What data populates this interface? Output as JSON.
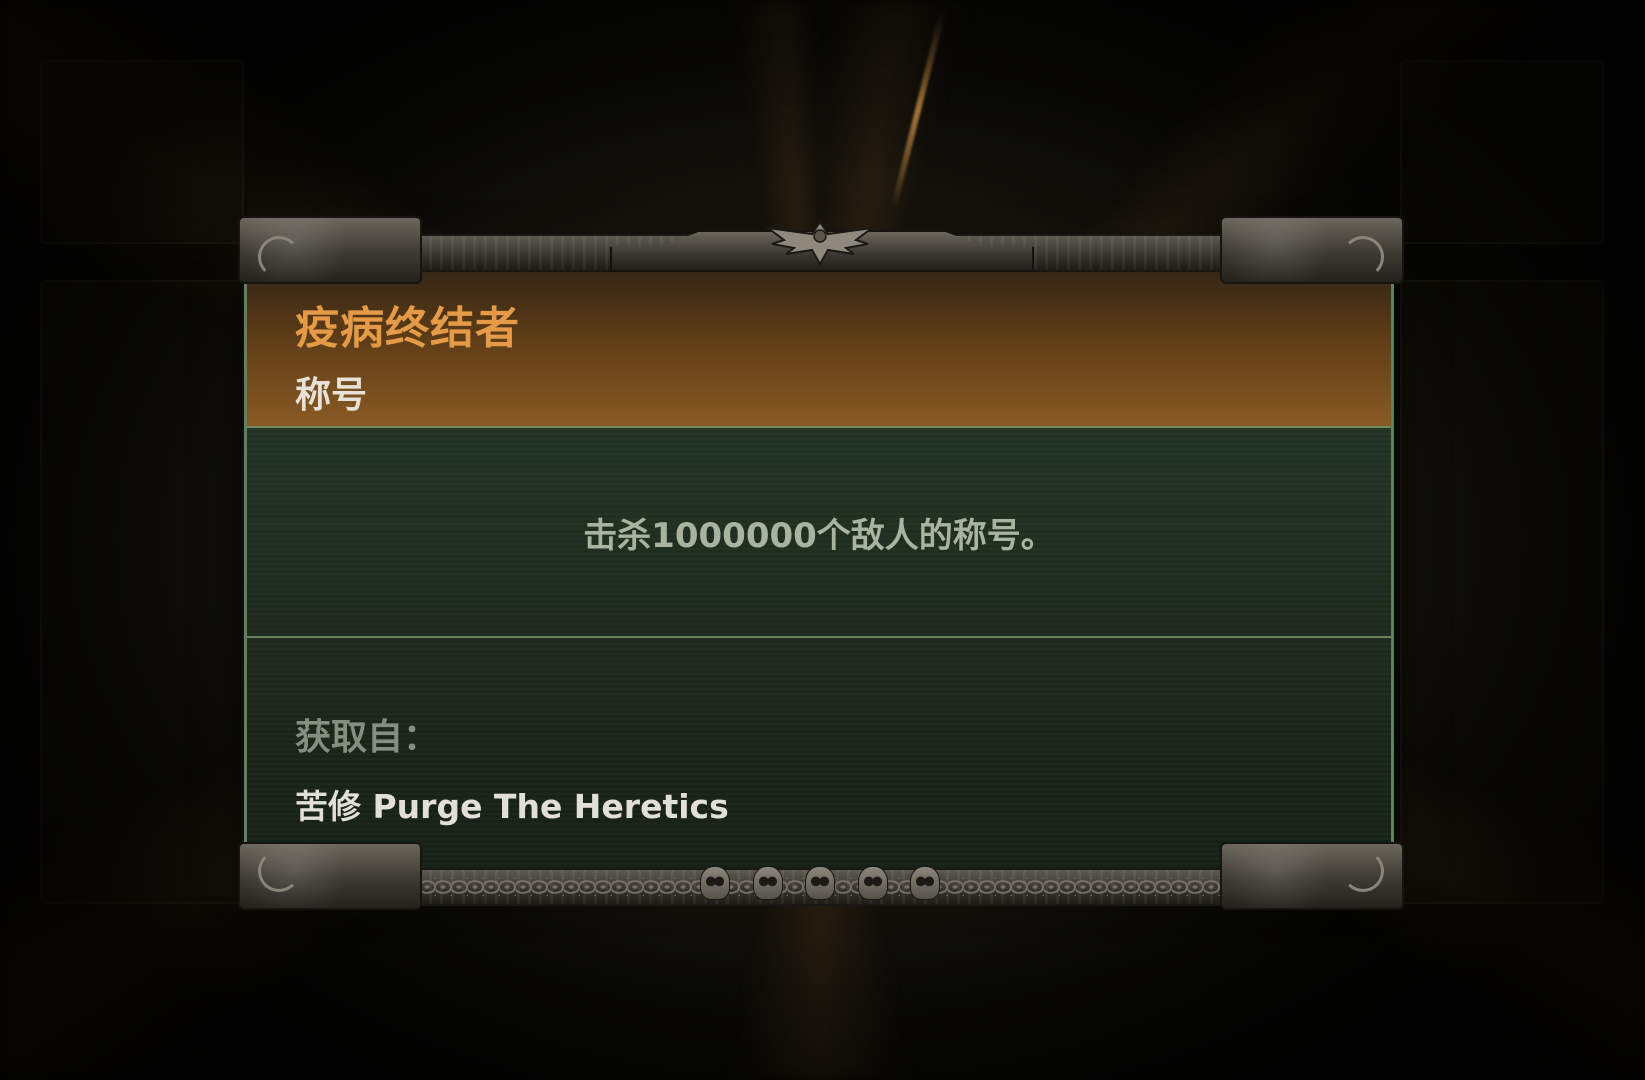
{
  "card": {
    "title": "疫病终结者",
    "category": "称号",
    "description": "击杀1000000个敌人的称号。",
    "source_label": "获取自：",
    "source_value": "苦修 Purge The Heretics"
  },
  "colors": {
    "title": "#e59a47",
    "header_gradient_end": "#8a5a24",
    "panel_green": "#1f2a1f",
    "border_green": "#6b8460"
  },
  "icons": {
    "crest": "aquila-icon",
    "bottom_ornament": "skull-icon"
  }
}
